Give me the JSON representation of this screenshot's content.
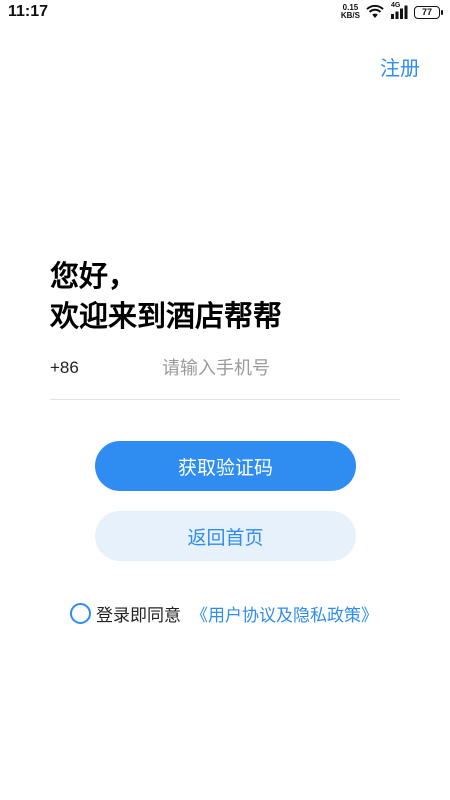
{
  "status_bar": {
    "time": "11:17",
    "speed_value": "0.15",
    "speed_unit": "KB/S",
    "network": "4G",
    "battery": "77"
  },
  "header": {
    "register_label": "注册"
  },
  "greeting": {
    "line1": "您好，",
    "line2": "欢迎来到酒店帮帮"
  },
  "phone": {
    "country_code": "+86",
    "placeholder": "请输入手机号",
    "value": ""
  },
  "buttons": {
    "get_code_label": "获取验证码",
    "back_home_label": "返回首页"
  },
  "agreement": {
    "text": "登录即同意",
    "link": "《用户协议及隐私政策》"
  },
  "colors": {
    "accent": "#2f8cf0",
    "secondary_button_bg": "#e6f1fc",
    "divider": "#e2e2e2"
  },
  "icons": {
    "wifi": "wifi-icon",
    "signal": "signal-icon",
    "battery": "battery-icon",
    "agree_radio": "radio-circle-icon"
  }
}
